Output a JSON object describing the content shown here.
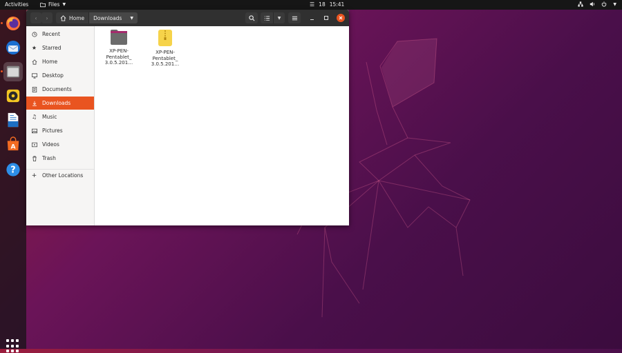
{
  "topbar": {
    "activities": "Activities",
    "app_menu": "Files",
    "date": "18",
    "time": "15:41"
  },
  "dock": {
    "items": [
      "firefox-icon",
      "thunderbird-icon",
      "files-icon",
      "rhythmbox-icon",
      "writer-icon",
      "software-icon",
      "help-icon"
    ]
  },
  "window": {
    "path": [
      {
        "label": "Home"
      },
      {
        "label": "Downloads"
      }
    ],
    "sidebar": [
      {
        "label": "Recent",
        "icon": "clock-icon"
      },
      {
        "label": "Starred",
        "icon": "star-icon"
      },
      {
        "label": "Home",
        "icon": "home-icon"
      },
      {
        "label": "Desktop",
        "icon": "desktop-icon"
      },
      {
        "label": "Documents",
        "icon": "document-icon"
      },
      {
        "label": "Downloads",
        "icon": "download-icon",
        "selected": true
      },
      {
        "label": "Music",
        "icon": "music-icon"
      },
      {
        "label": "Pictures",
        "icon": "picture-icon"
      },
      {
        "label": "Videos",
        "icon": "video-icon"
      },
      {
        "label": "Trash",
        "icon": "trash-icon"
      },
      {
        "label": "Other Locations",
        "icon": "plus-icon"
      }
    ],
    "files": [
      {
        "line1": "XP-PEN-",
        "line2": "Pentablet_",
        "line3": "3.0.5.201…",
        "type": "folder"
      },
      {
        "line1": "XP-PEN-",
        "line2": "Pentablet_",
        "line3": "3.0.5.201…",
        "type": "archive"
      }
    ]
  },
  "colors": {
    "accent": "#e95420",
    "headerbar": "#303030",
    "topbar": "#161616"
  }
}
